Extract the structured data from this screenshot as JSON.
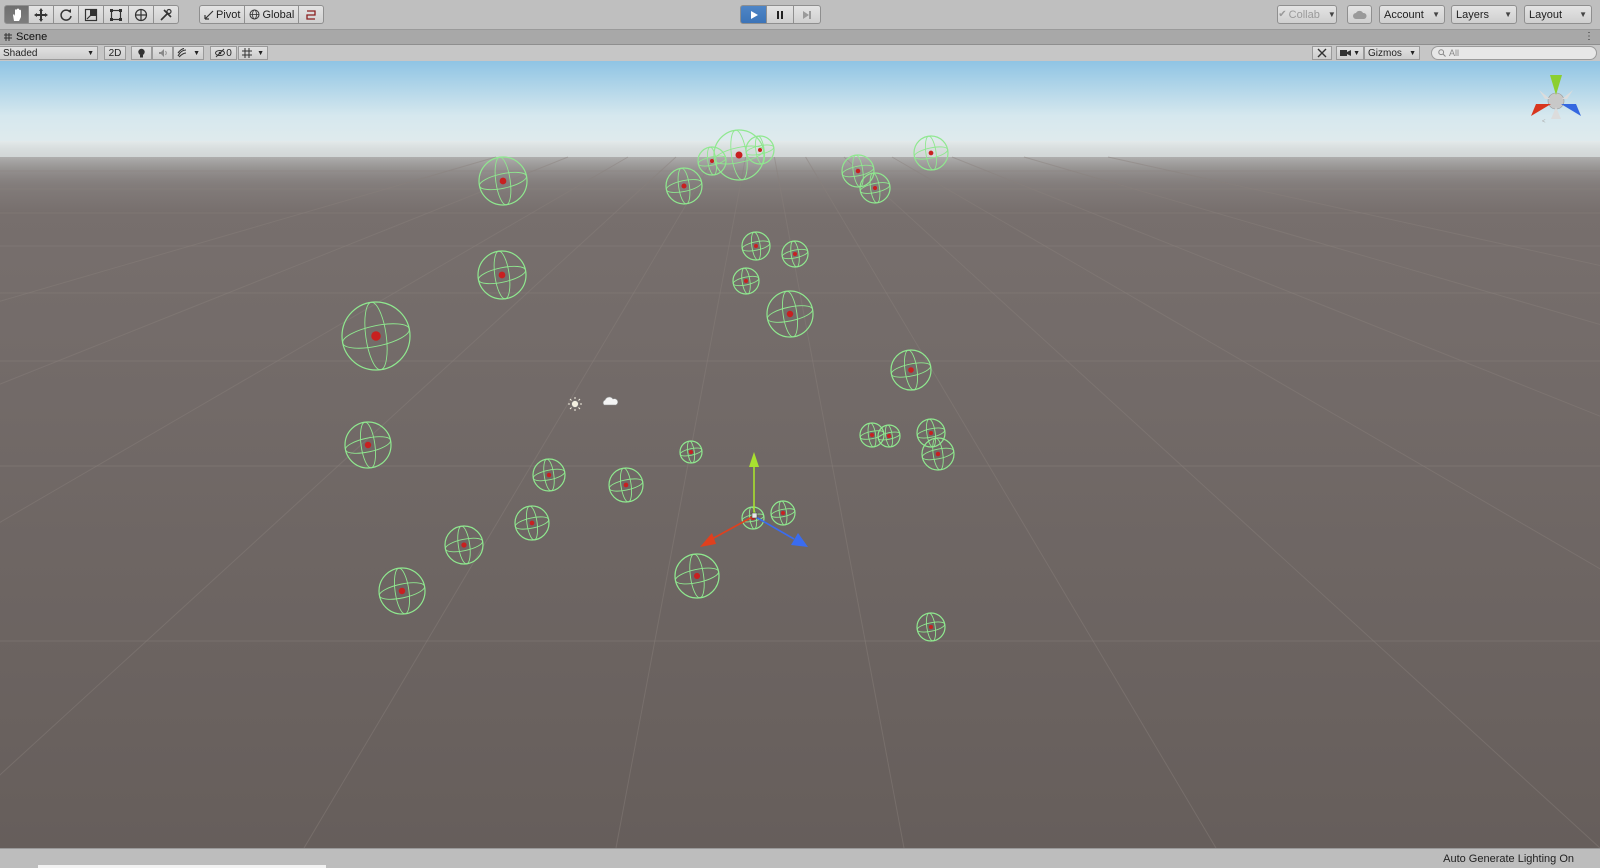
{
  "toolbar": {
    "tools": [
      {
        "name": "hand-tool",
        "icon": "hand-icon",
        "active": true
      },
      {
        "name": "move-tool",
        "icon": "move-arrows-icon",
        "active": false
      },
      {
        "name": "rotate-tool",
        "icon": "rotate-icon",
        "active": false
      },
      {
        "name": "scale-tool",
        "icon": "scale-icon",
        "active": false
      },
      {
        "name": "rect-tool",
        "icon": "rect-transform-icon",
        "active": false
      },
      {
        "name": "transform-tool",
        "icon": "transform-icon",
        "active": false
      },
      {
        "name": "custom-tool",
        "icon": "custom-tools-icon",
        "active": false
      }
    ],
    "pivot_label": "Pivot",
    "global_label": "Global",
    "snap_icon": "grid-snap-icon",
    "play_icon": "play-icon",
    "pause_icon": "pause-icon",
    "step_icon": "step-icon",
    "collab_label": "Collab",
    "cloud_icon": "cloud-icon",
    "account_label": "Account",
    "layers_label": "Layers",
    "layout_label": "Layout"
  },
  "scene_tab": {
    "title": "Scene",
    "icon": "scene-grid-icon"
  },
  "scene_toolbar": {
    "shading_mode": "Shaded",
    "two_d_label": "2D",
    "lighting_icon": "lightbulb-icon",
    "audio_icon": "speaker-icon",
    "effects_icon": "effects-icon",
    "hidden_count": "0",
    "hidden_icon": "eye-slash-icon",
    "grid_icon": "grid-icon",
    "tools_icon": "tools-icon",
    "camera_icon": "camera-icon",
    "gizmos_label": "Gizmos",
    "search_placeholder": "All"
  },
  "scene_objects": {
    "directional_light_icon": "sun-icon",
    "skybox_icon": "cloud-icon",
    "orientation_gizmo_icon": "axis-gizmo-icon",
    "colors": {
      "sphere_collider": "#8fe88f",
      "center_point": "#c82020",
      "x_axis": "#e0401e",
      "y_axis": "#a8e030",
      "z_axis": "#3a6cf0",
      "ground": "#6b6360",
      "sky_top": "#8fc4e4"
    }
  },
  "status_bar": {
    "text": "Auto Generate Lighting On"
  }
}
